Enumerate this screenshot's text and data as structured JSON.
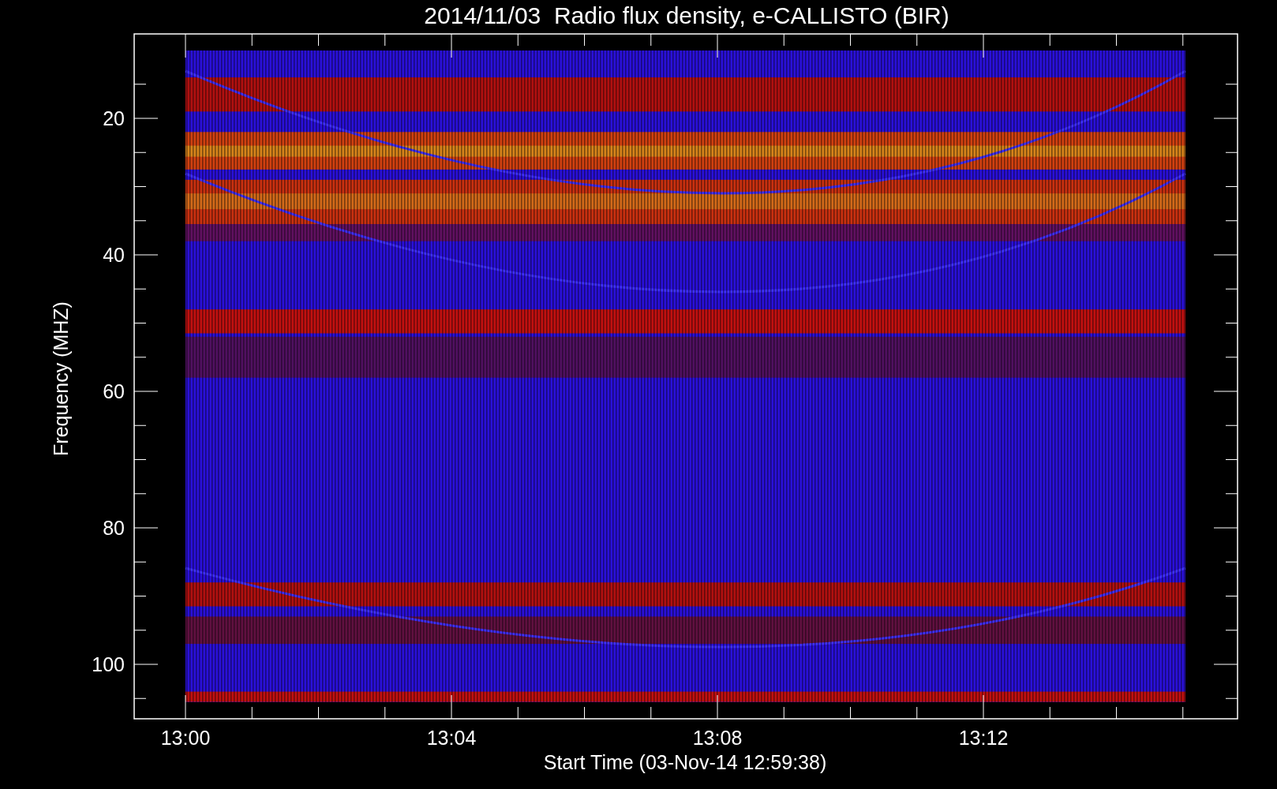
{
  "title": "2014/11/03  Radio flux density, e-CALLISTO (BIR)",
  "ylabel": "Frequency (MHZ)",
  "xlabel": "Start Time (03-Nov-14 12:59:38)",
  "yticks": [
    "20",
    "40",
    "60",
    "80",
    "100"
  ],
  "xticks": [
    "13:00",
    "13:04",
    "13:08",
    "13:12"
  ]
}
